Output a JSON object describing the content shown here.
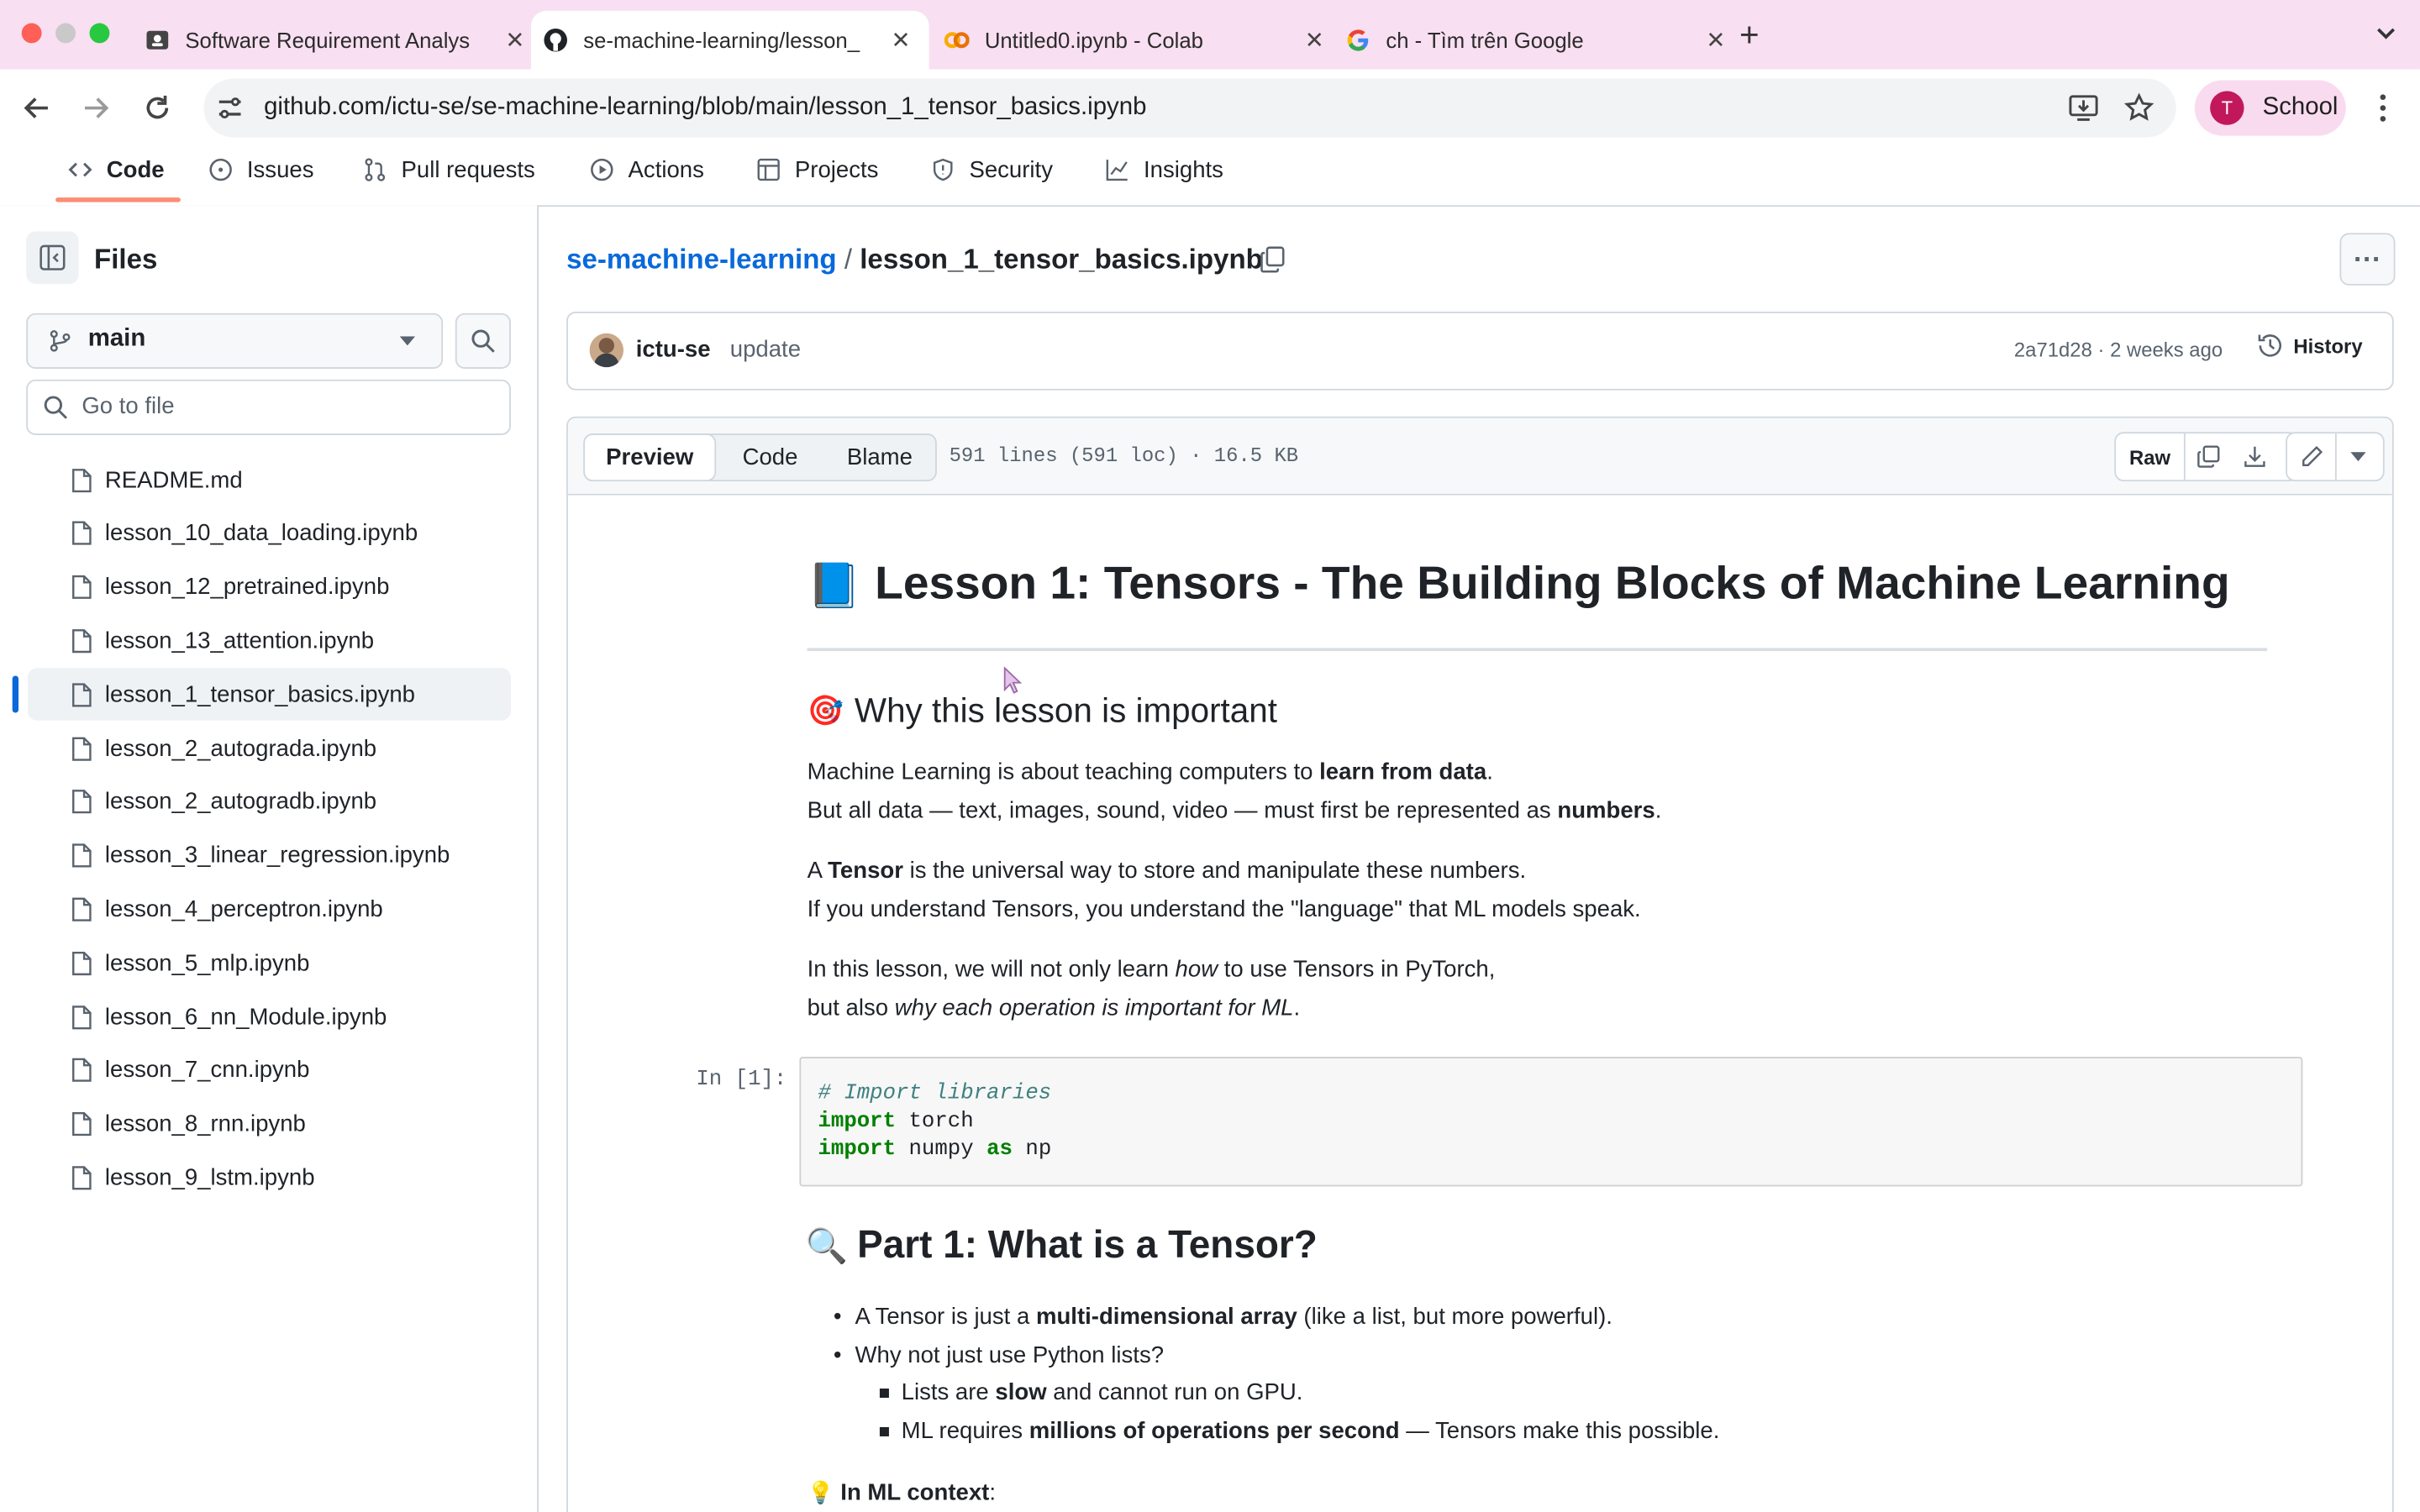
{
  "browser": {
    "tabs": [
      {
        "title": "Software Requirement Analys",
        "close": "✕"
      },
      {
        "title": "se-machine-learning/lesson_",
        "close": "✕"
      },
      {
        "title": "Untitled0.ipynb - Colab",
        "close": "✕"
      },
      {
        "title": "ch - Tìm trên Google",
        "close": "✕"
      }
    ],
    "new_tab": "+",
    "url": "github.com/ictu-se/se-machine-learning/blob/main/lesson_1_tensor_basics.ipynb",
    "profile_initial": "T",
    "profile_name": "School"
  },
  "repo_nav": {
    "items": [
      "Code",
      "Issues",
      "Pull requests",
      "Actions",
      "Projects",
      "Security",
      "Insights"
    ]
  },
  "sidebar": {
    "title": "Files",
    "branch": "main",
    "go_to_file_placeholder": "Go to file",
    "files": [
      "README.md",
      "lesson_10_data_loading.ipynb",
      "lesson_12_pretrained.ipynb",
      "lesson_13_attention.ipynb",
      "lesson_1_tensor_basics.ipynb",
      "lesson_2_autograda.ipynb",
      "lesson_2_autogradb.ipynb",
      "lesson_3_linear_regression.ipynb",
      "lesson_4_perceptron.ipynb",
      "lesson_5_mlp.ipynb",
      "lesson_6_nn_Module.ipynb",
      "lesson_7_cnn.ipynb",
      "lesson_8_rnn.ipynb",
      "lesson_9_lstm.ipynb"
    ],
    "selected_index": 4
  },
  "file_header": {
    "repo": "se-machine-learning",
    "sep": "/",
    "filename": "lesson_1_tensor_basics.ipynb",
    "more": "···"
  },
  "commit": {
    "author": "ictu-se",
    "message": "update",
    "meta": "2a71d28 · 2 weeks ago",
    "history": "History"
  },
  "viewer": {
    "tabs": [
      "Preview",
      "Code",
      "Blame"
    ],
    "info": "591 lines (591 loc) · 16.5 KB",
    "raw": "Raw"
  },
  "notebook": {
    "h1_icon": "📘",
    "h1": "Lesson 1: Tensors - The Building Blocks of Machine Learning",
    "h2a_icon": "🎯",
    "h2a": "Why this lesson is important",
    "p1": {
      "a": "Machine Learning is about teaching computers to ",
      "b": "learn from data",
      "c": "."
    },
    "p2": {
      "a": "But all data — text, images, sound, video — must first be represented as ",
      "b": "numbers",
      "c": "."
    },
    "p3": {
      "a": "A ",
      "b": "Tensor",
      "c": " is the universal way to store and manipulate these numbers."
    },
    "p4": "If you understand Tensors, you understand the \"language\" that ML models speak.",
    "p5": {
      "a": "In this lesson, we will not only learn ",
      "b": "how",
      "c": " to use Tensors in PyTorch,"
    },
    "p6": {
      "a": "but also ",
      "b": "why each operation is important for ML",
      "c": "."
    },
    "cell_prompt": "In [1]:",
    "code": {
      "comment": "# Import libraries",
      "kw1": "import",
      "l2": " torch",
      "kw2": "import",
      "l3a": " numpy ",
      "kw3": "as",
      "l3b": " np"
    },
    "h2b_icon": "🔍",
    "h2b": "Part 1: What is a Tensor?",
    "b1": {
      "a": "A Tensor is just a ",
      "b": "multi-dimensional array",
      "c": " (like a list, but more powerful)."
    },
    "b2": "Why not just use Python lists?",
    "b3": {
      "a": "Lists are ",
      "b": "slow",
      "c": " and cannot run on GPU."
    },
    "b4": {
      "a": "ML requires ",
      "b": "millions of operations per second",
      "c": " — Tensors make this possible."
    },
    "p7_icon": "💡",
    "p7": {
      "b": "In ML context",
      "c": ":"
    }
  },
  "colors": {
    "accent": "#0969da",
    "tabbar": "#f8dff1",
    "profile": "#c2185b"
  }
}
